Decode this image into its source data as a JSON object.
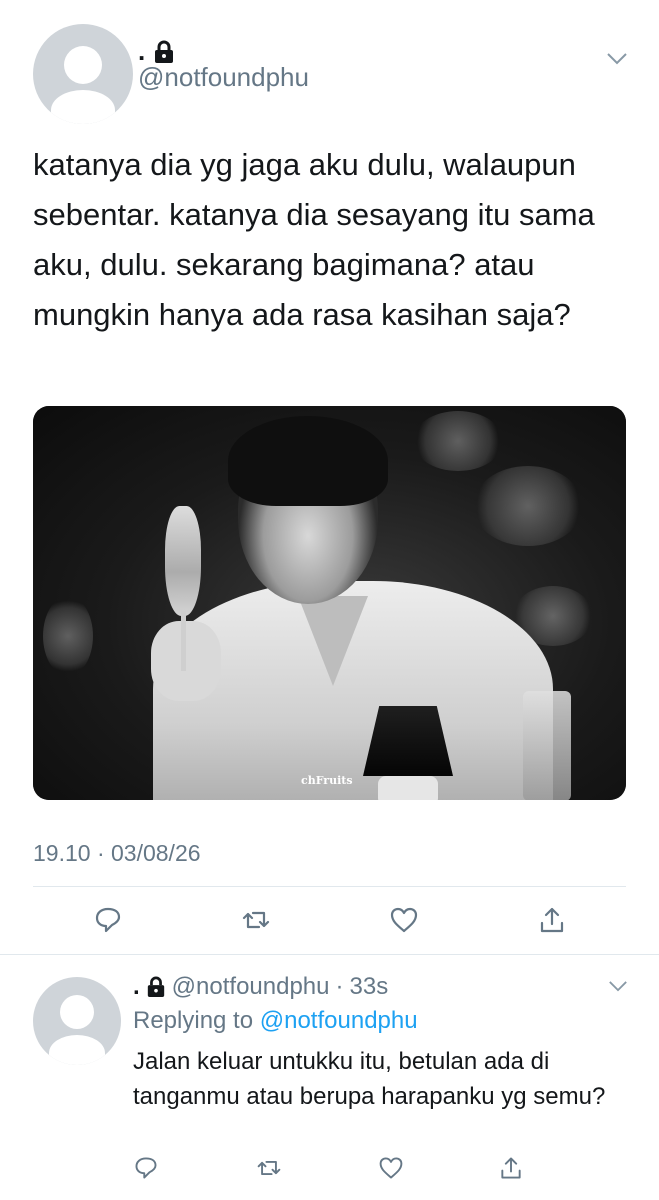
{
  "tweet": {
    "display_name": ".",
    "handle": "@notfoundphu",
    "text": "katanya dia yg jaga aku dulu, walaupun sebentar. katanya dia sesayang itu sama aku, dulu. sekarang bagimana? atau mungkin hanya ada rasa kasihan saja?",
    "timestamp": "19.10 · 03/08/26",
    "photo_watermark": "chFruits",
    "icons": [
      "lock-icon",
      "chevron-down-icon",
      "reply-icon",
      "retweet-icon",
      "like-icon",
      "share-icon"
    ]
  },
  "reply": {
    "display_name": ".",
    "handle": "@notfoundphu",
    "separator": "·",
    "time_ago": "33s",
    "replying_prefix": "Replying to",
    "replying_to": "@notfoundphu",
    "text": "Jalan keluar untukku itu, betulan ada di tanganmu atau berupa harapanku yg semu?"
  },
  "colors": {
    "text": "#14171a",
    "secondary": "#657786",
    "link": "#1da1f2",
    "divider": "#e1e8ed",
    "avatar_bg": "#cfd4d9"
  }
}
